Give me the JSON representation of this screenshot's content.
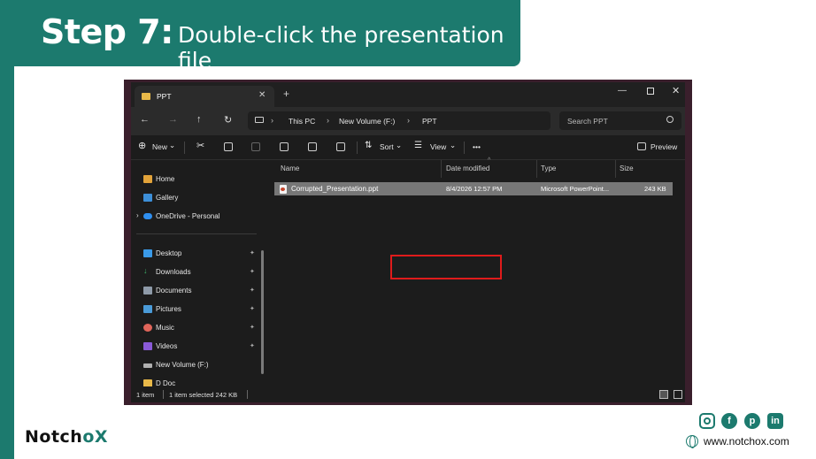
{
  "banner": {
    "step": "Step 7:",
    "description": "Double-click the presentation file"
  },
  "explorer": {
    "tab": {
      "label": "PPT",
      "close": "✕",
      "new_tab": "+"
    },
    "window_controls": {
      "minimize": "—",
      "close": "✕"
    },
    "nav_buttons": {
      "back": "←",
      "forward": "→",
      "up": "↑",
      "refresh": "↻"
    },
    "breadcrumb": [
      "This PC",
      "New Volume (F:)",
      "PPT"
    ],
    "breadcrumb_separator": "›",
    "search": {
      "placeholder": "Search PPT"
    },
    "toolbar": {
      "new_label": "New",
      "sort_label": "Sort",
      "view_label": "View",
      "more_label": "•••",
      "preview_label": "Preview",
      "dropdown_caret": "⌄"
    },
    "sidebar": {
      "items": [
        {
          "label": "Home",
          "icon": "home-icon",
          "pinned": false
        },
        {
          "label": "Gallery",
          "icon": "gallery-icon",
          "pinned": false
        },
        {
          "label": "OneDrive - Personal",
          "icon": "onedrive-icon",
          "pinned": false
        },
        {
          "label": "Desktop",
          "icon": "desktop-icon",
          "pinned": true
        },
        {
          "label": "Downloads",
          "icon": "downloads-icon",
          "pinned": true
        },
        {
          "label": "Documents",
          "icon": "documents-icon",
          "pinned": true
        },
        {
          "label": "Pictures",
          "icon": "pictures-icon",
          "pinned": true
        },
        {
          "label": "Music",
          "icon": "music-icon",
          "pinned": true
        },
        {
          "label": "Videos",
          "icon": "videos-icon",
          "pinned": true
        },
        {
          "label": "New Volume (F:)",
          "icon": "drive-icon",
          "pinned": false
        },
        {
          "label": "D Doc",
          "icon": "folder-icon",
          "pinned": false
        }
      ],
      "expander": "›",
      "pin_glyph": "📌"
    },
    "columns": [
      "Name",
      "Date modified",
      "Type",
      "Size"
    ],
    "sort_caret": "^",
    "files": [
      {
        "name": "Corrupted_Presentation.ppt",
        "date_modified": "8/4/2026 12:57 PM",
        "type": "Microsoft PowerPoint...",
        "size": "243 KB"
      }
    ],
    "status": {
      "count": "1 item",
      "selected": "1 item selected  242 KB"
    }
  },
  "footer": {
    "logo_text_a": "Notch",
    "logo_text_b": "o",
    "logo_text_c": "X",
    "website": "www.notchox.com",
    "social": [
      "instagram-icon",
      "facebook-icon",
      "pinterest-icon",
      "linkedin-icon"
    ]
  },
  "colors": {
    "brand": "#1c7a6e",
    "highlight": "#e01b1b",
    "explorer_bg": "#1c1c1c",
    "selected_row": "#777777"
  }
}
